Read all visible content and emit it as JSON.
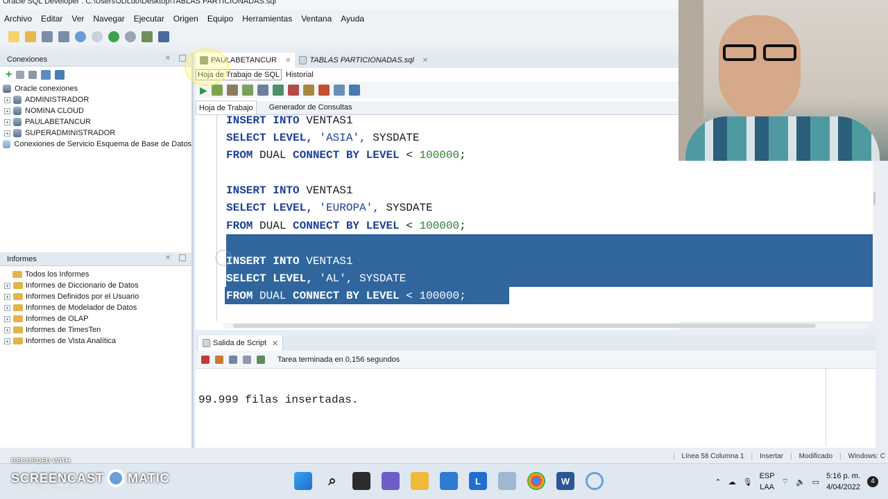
{
  "window": {
    "title": "Oracle SQL Developer : C:\\Users\\JDLdo\\Desktop\\TABLAS PARTICIONADAS.sql"
  },
  "menu": [
    "Archivo",
    "Editar",
    "Ver",
    "Navegar",
    "Ejecutar",
    "Origen",
    "Equipo",
    "Herramientas",
    "Ventana",
    "Ayuda"
  ],
  "connections": {
    "title": "Conexiones",
    "root": "Oracle conexiones",
    "items": [
      "ADMINISTRADOR",
      "NOMINA CLOUD",
      "PAULABETANCUR",
      "SUPERADMINISTRADOR"
    ],
    "schema_service": "Conexiones de Servicio Esquema de Base de Datos"
  },
  "reports": {
    "title": "Informes",
    "root": "Todos los Informes",
    "items": [
      "Informes de Diccionario de Datos",
      "Informes Definidos por el Usuario",
      "Informes de Modelador de Datos",
      "Informes de OLAP",
      "Informes de TimesTen",
      "Informes de Vista Analítica"
    ]
  },
  "editor": {
    "tabs": [
      "PAULABETANCUR",
      "TABLAS PARTICIONADAS.sql"
    ],
    "subtabs": [
      "Hoja de Trabajo de SQL",
      "Historial"
    ],
    "worksheet_tabs": [
      "Hoja de Trabajo",
      "Generador de Consultas"
    ],
    "code": {
      "l1": {
        "kw1": "INSERT INTO",
        "rest": " VENTAS1"
      },
      "l2": {
        "kw1": "SELECT LEVEL,",
        "str": " 'ASIA',",
        "rest": " SYSDATE"
      },
      "l3": {
        "kw1": "FROM",
        "rest1": " DUAL ",
        "kw2": "CONNECT BY LEVEL",
        "op": " < ",
        "num": "100000",
        "end": ";"
      },
      "l4": {
        "kw1": "INSERT INTO",
        "rest": " VENTAS1"
      },
      "l5": {
        "kw1": "SELECT LEVEL,",
        "str": " 'EUROPA',",
        "rest": " SYSDATE"
      },
      "l6": {
        "kw1": "FROM",
        "rest1": " DUAL ",
        "kw2": "CONNECT BY LEVEL",
        "op": " < ",
        "num": "100000",
        "end": ";"
      },
      "l7": {
        "kw1": "INSERT INTO",
        "rest": " VENTAS1"
      },
      "l8": {
        "kw1": "SELECT LEVEL,",
        "str": " 'AL',",
        "rest": " SYSDATE"
      },
      "l9": {
        "kw1": "FROM",
        "rest1": " DUAL ",
        "kw2": "CONNECT BY LEVEL",
        "op": " < ",
        "num": "100000",
        "end": ";"
      }
    }
  },
  "script_output": {
    "tab": "Salida de Script",
    "status": "Tarea terminada en 0,156 segundos",
    "text": "99.999 filas insertadas."
  },
  "statusbar": {
    "position": "Línea 58 Columna 1",
    "mode": "Insertar",
    "modified": "Modificado",
    "os": "Windows: C"
  },
  "watermark": {
    "recorded": "RECORDED WITH",
    "brand_a": "SCREENCAST",
    "brand_b": "MATIC",
    "sub": "Torm elec inten"
  },
  "taskbar": {
    "lang1": "ESP",
    "lang2": "LAA",
    "time": "5:16 p. m.",
    "date": "4/04/2022",
    "notifications": "4"
  },
  "colors": {
    "selection": "#30659e",
    "keyword": "#1d3f9a",
    "number": "#2e7d32"
  }
}
